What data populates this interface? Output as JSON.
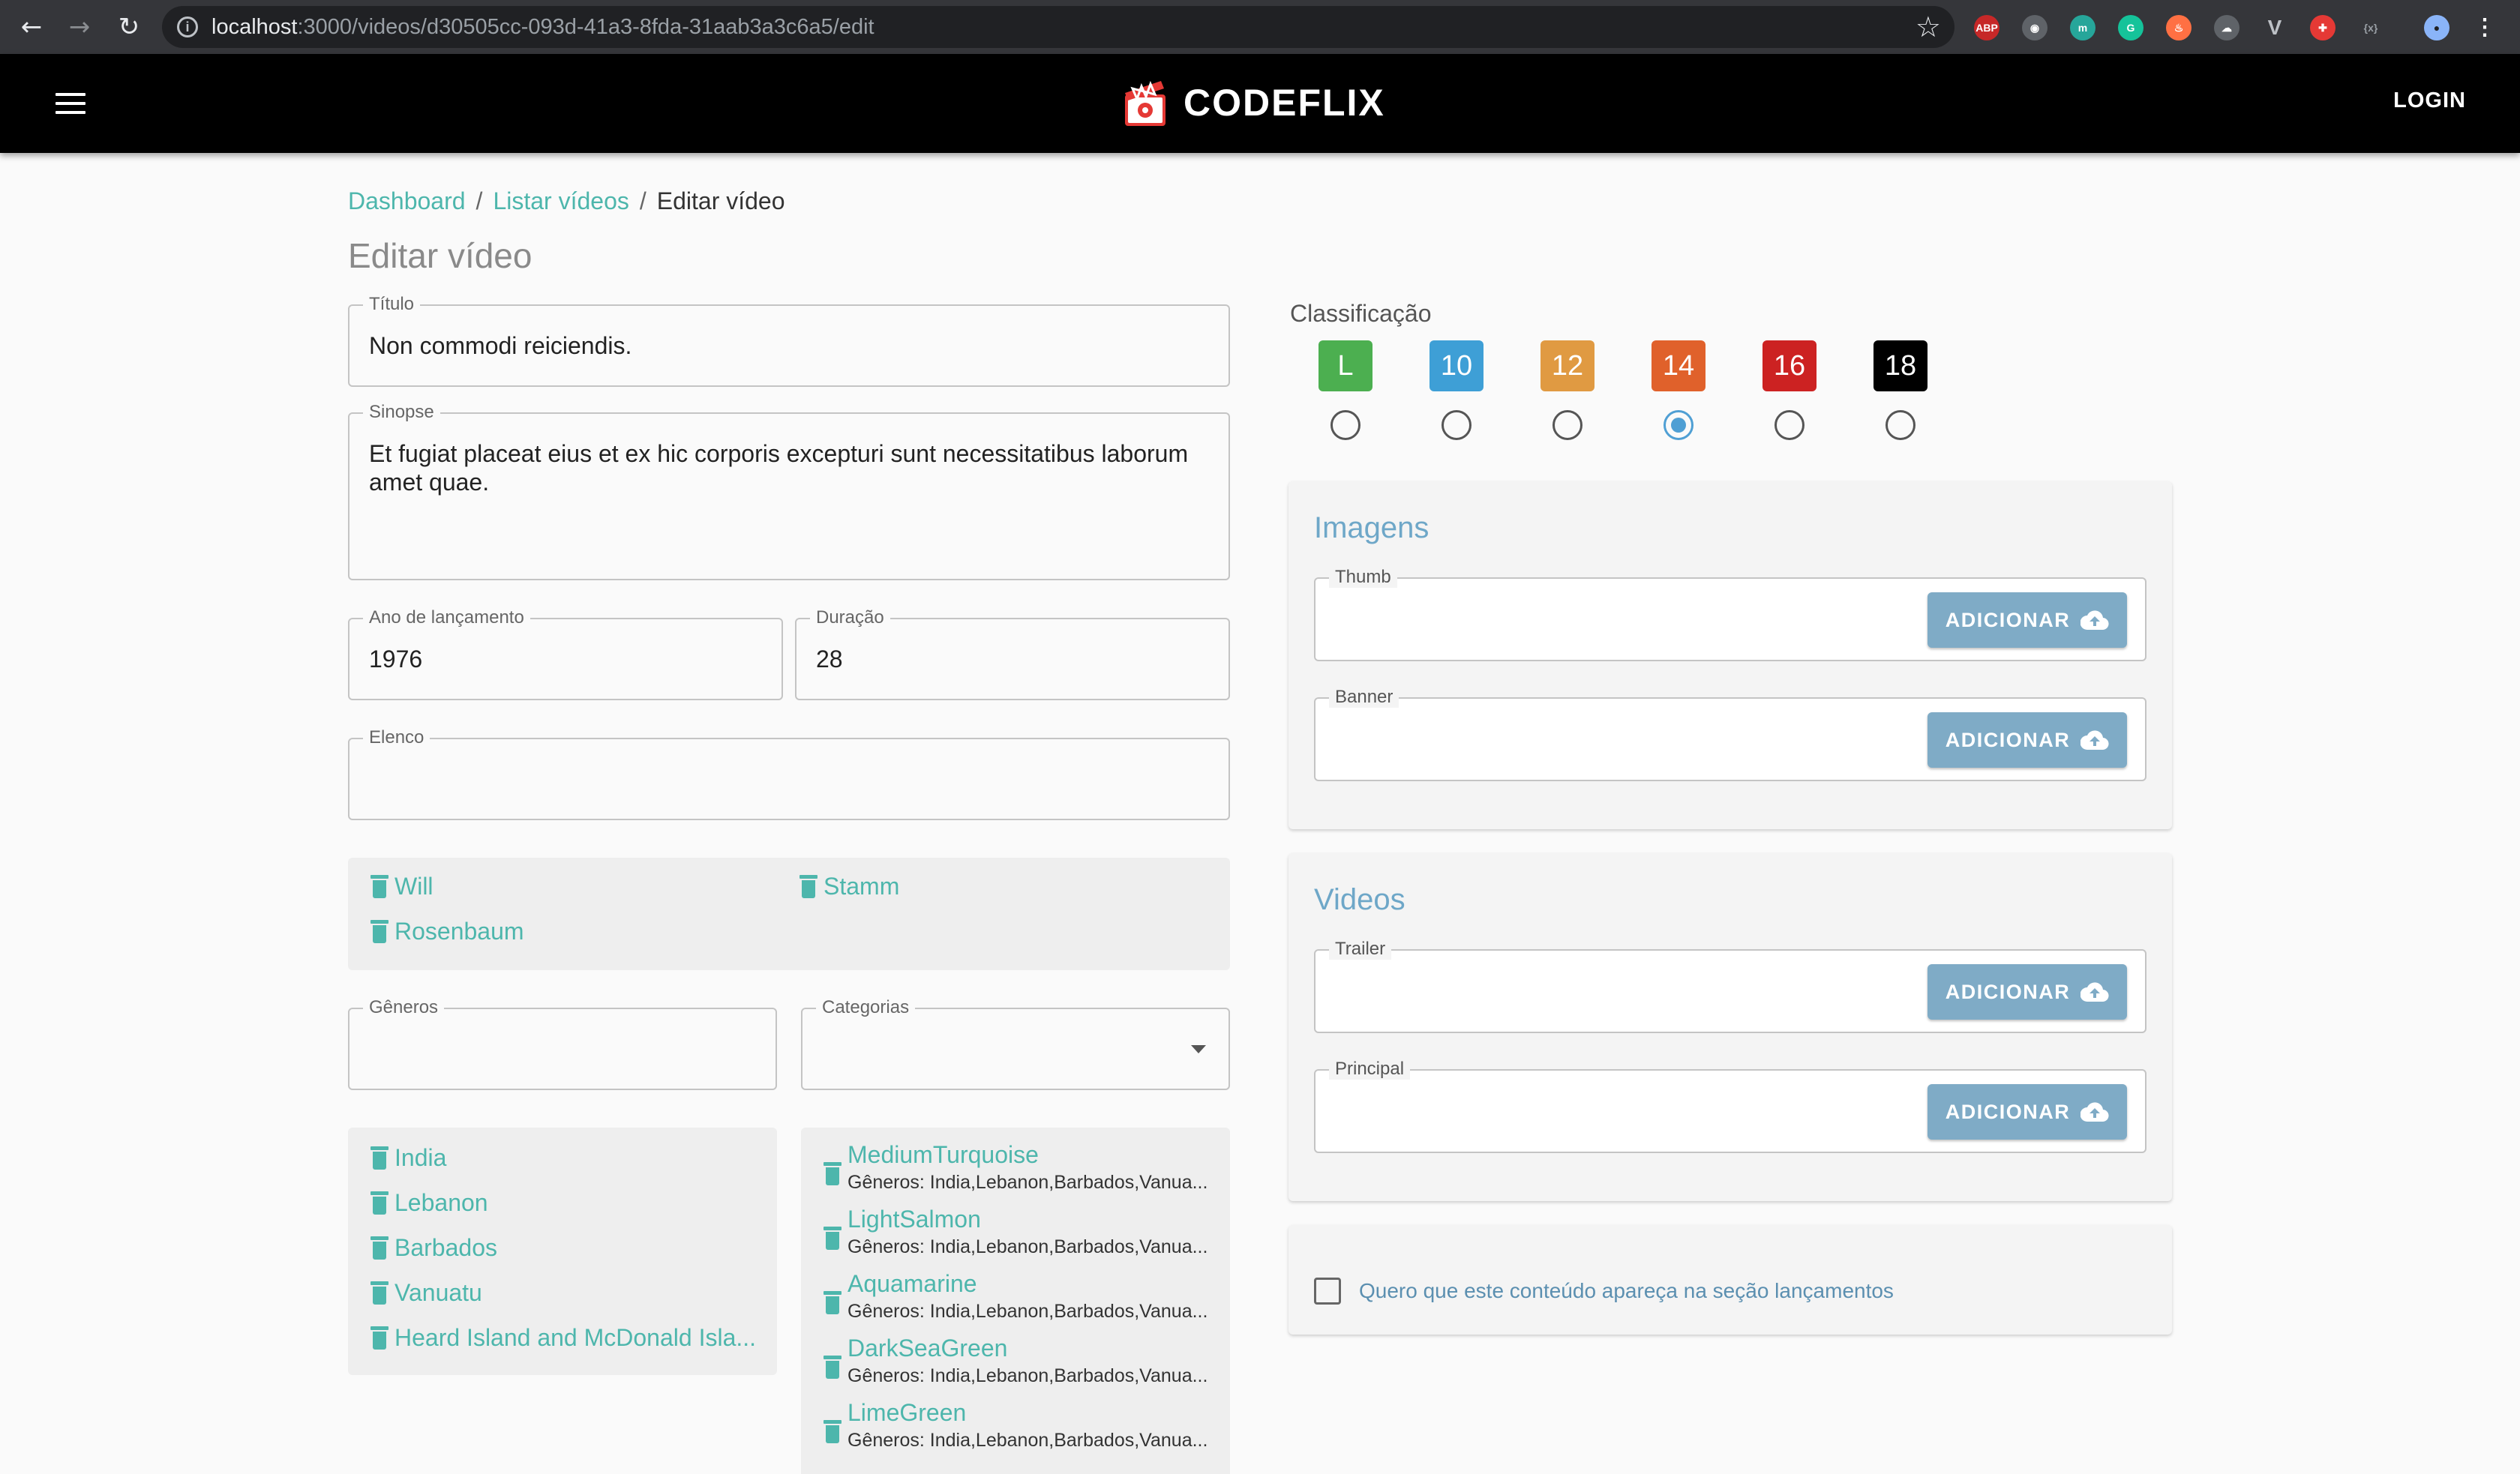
{
  "browser": {
    "url_host": "localhost",
    "url_rest": ":3000/videos/d30505cc-093d-41a3-8fda-31aab3a3c6a5/edit"
  },
  "appbar": {
    "brand": "CODEFLIX",
    "login_label": "LOGIN"
  },
  "breadcrumb": {
    "items": [
      "Dashboard",
      "Listar vídeos",
      "Editar vídeo"
    ],
    "separator": "/"
  },
  "page_title": "Editar vídeo",
  "form": {
    "titulo": {
      "label": "Título",
      "value": "Non commodi reiciendis."
    },
    "sinopse": {
      "label": "Sinopse",
      "value": "Et fugiat placeat eius et ex hic corporis excepturi sunt necessitatibus laborum amet quae."
    },
    "ano": {
      "label": "Ano de lançamento",
      "value": "1976"
    },
    "duracao": {
      "label": "Duração",
      "value": "28"
    },
    "elenco": {
      "label": "Elenco",
      "value": ""
    },
    "cast_members": [
      "Will",
      "Stamm",
      "Rosenbaum"
    ],
    "generos": {
      "label": "Gêneros",
      "value": ""
    },
    "categorias": {
      "label": "Categorias",
      "value": ""
    },
    "genre_list": [
      "India",
      "Lebanon",
      "Barbados",
      "Vanuatu",
      "Heard Island and McDonald Isla..."
    ],
    "category_list": [
      {
        "name": "MediumTurquoise",
        "sub": "Gêneros: India,Lebanon,Barbados,Vanua..."
      },
      {
        "name": "LightSalmon",
        "sub": "Gêneros: India,Lebanon,Barbados,Vanua..."
      },
      {
        "name": "Aquamarine",
        "sub": "Gêneros: India,Lebanon,Barbados,Vanua..."
      },
      {
        "name": "DarkSeaGreen",
        "sub": "Gêneros: India,Lebanon,Barbados,Vanua..."
      },
      {
        "name": "LimeGreen",
        "sub": "Gêneros: India,Lebanon,Barbados,Vanua..."
      }
    ]
  },
  "classificacao": {
    "label": "Classificação",
    "options": [
      {
        "label": "L",
        "color": "#4caf50"
      },
      {
        "label": "10",
        "color": "#3e9fd6"
      },
      {
        "label": "12",
        "color": "#e09a42"
      },
      {
        "label": "14",
        "color": "#e0612b"
      },
      {
        "label": "16",
        "color": "#cc2222"
      },
      {
        "label": "18",
        "color": "#000000"
      }
    ],
    "selected": "14"
  },
  "imagens": {
    "title": "Imagens",
    "thumb_label": "Thumb",
    "banner_label": "Banner"
  },
  "videos": {
    "title": "Videos",
    "trailer_label": "Trailer",
    "principal_label": "Principal"
  },
  "upload_button_label": "ADICIONAR",
  "lancamento_checkbox": {
    "label": "Quero que este conteúdo apareça na seção lançamentos",
    "checked": false
  },
  "colors": {
    "accent": "#4db6ac",
    "card_title": "#6ea7c8",
    "button": "#7fabc6"
  }
}
